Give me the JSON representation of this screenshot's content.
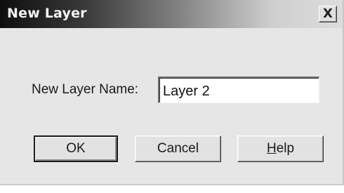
{
  "window": {
    "title": "New Layer",
    "close_icon": "close-icon",
    "close_glyph": "X"
  },
  "form": {
    "name_label": "New Layer Name:",
    "name_value": "Layer 2"
  },
  "buttons": {
    "ok_label": "OK",
    "cancel_label": "Cancel",
    "help_mnemonic": "H",
    "help_rest": "elp"
  },
  "colors": {
    "dialog_background": "#e6e6e6",
    "titlebar_start": "#0e0e0e",
    "titlebar_end": "#dcdcdc"
  }
}
